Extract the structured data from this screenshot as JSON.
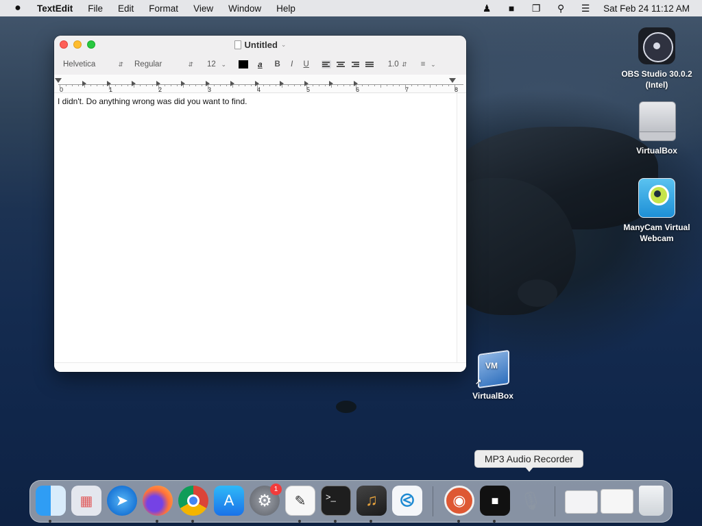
{
  "menubar": {
    "apple_icon": "apple-icon",
    "app_name": "TextEdit",
    "menus": [
      "File",
      "Edit",
      "Format",
      "View",
      "Window",
      "Help"
    ],
    "status_icons": [
      "user-switch-icon",
      "facetime-camera-icon",
      "screen-mirroring-icon",
      "search-icon",
      "control-center-icon"
    ],
    "clock": "Sat Feb 24  11:12 AM"
  },
  "window": {
    "title": "Untitled",
    "toolbar": {
      "font_family": "Helvetica",
      "font_style": "Regular",
      "font_size": "12",
      "text_color": "#000000",
      "bold": "B",
      "italic": "I",
      "underline": "U",
      "line_spacing": "1.0"
    },
    "ruler_numbers": [
      "0",
      "1",
      "2",
      "3",
      "4",
      "5",
      "6",
      "7",
      "8"
    ],
    "document_text": "I didn't. Do anything wrong was did you want to find."
  },
  "desktop_icons": [
    {
      "label": "OBS Studio 30.0.2 (Intel)"
    },
    {
      "label": "VirtualBox"
    },
    {
      "label": "ManyCam Virtual Webcam"
    },
    {
      "label": "VirtualBox"
    }
  ],
  "tooltip": "MP3 Audio Recorder",
  "dock": {
    "apps": [
      "Finder",
      "Launchpad",
      "Safari",
      "Firefox",
      "Google Chrome",
      "App Store",
      "System Preferences",
      "TextEdit",
      "Terminal",
      "GarageBand",
      "Visual Studio Code",
      "DuckDuckGo",
      "Screen Recorder",
      "MP3 Audio Recorder",
      "Downloads",
      "Documents",
      "Trash"
    ],
    "system_prefs_badge": "1"
  }
}
